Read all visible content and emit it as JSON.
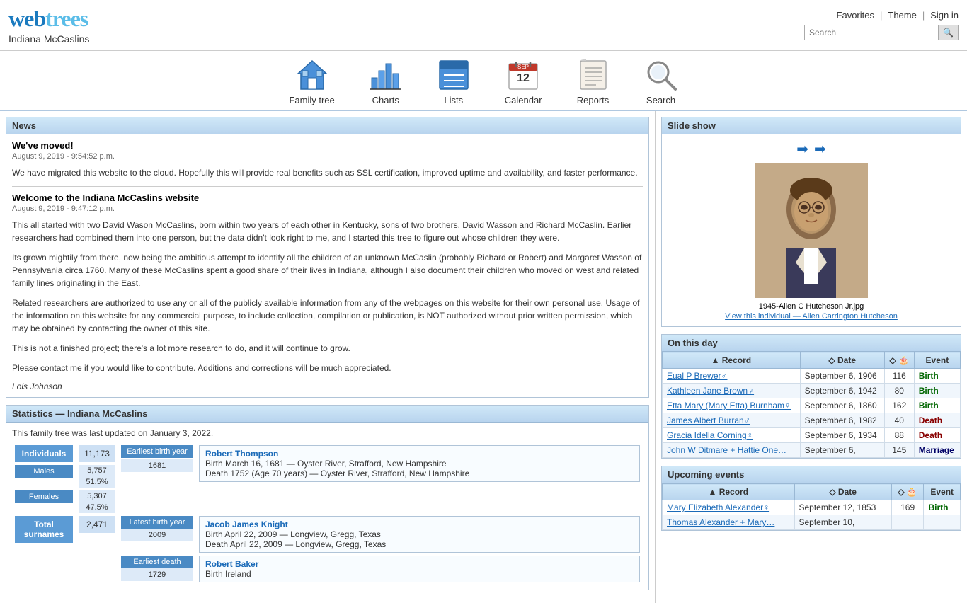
{
  "header": {
    "logo": "webtrees",
    "site_title": "Indiana McCaslins",
    "links": [
      "Favorites",
      "Theme",
      "Sign in"
    ],
    "search_placeholder": "Search"
  },
  "nav": {
    "items": [
      {
        "label": "Family tree",
        "icon": "house"
      },
      {
        "label": "Charts",
        "icon": "chart"
      },
      {
        "label": "Lists",
        "icon": "list"
      },
      {
        "label": "Calendar",
        "icon": "calendar"
      },
      {
        "label": "Reports",
        "icon": "reports"
      },
      {
        "label": "Search",
        "icon": "search"
      }
    ]
  },
  "news": {
    "section_label": "News",
    "items": [
      {
        "title": "We've moved!",
        "date": "August 9, 2019 - 9:54:52 p.m.",
        "text": "We have migrated this website to the cloud. Hopefully this will provide real benefits such as SSL certification, improved uptime and availability, and faster performance."
      },
      {
        "title": "Welcome to the Indiana McCaslins website",
        "date": "August 9, 2019 - 9:47:12 p.m.",
        "text1": "This all started with two David Wason McCaslins, born within two years of each other in Kentucky, sons of two brothers, David Wasson and Richard McCaslin. Earlier researchers had combined them into one person, but the data didn't look right to me, and I started this tree to figure out whose children they were.",
        "text2": "Its grown mightily from there, now being the ambitious attempt to identify all the children of an unknown McCaslin (probably Richard or Robert) and Margaret Wasson of Pennsylvania circa 1760. Many of these McCaslins spent a good share of their lives in Indiana, although I also document their children who moved on west and related family lines originating in the East.",
        "text3": "Related researchers are authorized to use any or all of the publicly available information from any of the webpages on this website for their own personal use. Usage of the information on this website for any commercial purpose, to include collection, compilation or publication, is NOT authorized without prior written permission, which may be obtained by contacting the owner of this site.",
        "text4": "This is not a finished project; there's a lot more research to do, and it will continue to grow.",
        "text5": "Please contact me if you would like to contribute. Additions and corrections will be much appreciated.",
        "signature": "Lois Johnson"
      }
    ]
  },
  "statistics": {
    "section_label": "Statistics — Indiana McCaslins",
    "last_updated": "This family tree was last updated on January 3, 2022.",
    "individuals": {
      "label": "Individuals",
      "value": "11,173"
    },
    "males": {
      "label": "Males",
      "value": "5,757",
      "pct": "51.5%"
    },
    "females": {
      "label": "Females",
      "value": "5,307",
      "pct": "47.5%"
    },
    "total_surnames": {
      "label": "Total surnames",
      "value": "2,471"
    },
    "earliest_birth": {
      "label": "Earliest birth year",
      "year": "1681",
      "name": "Robert Thompson",
      "birth": "Birth  March 16, 1681 — Oyster River, Strafford, New Hampshire",
      "death": "Death  1752 (Age 70 years) — Oyster River, Strafford, New Hampshire"
    },
    "latest_birth": {
      "label": "Latest birth year",
      "year": "2009",
      "name": "Jacob James Knight",
      "birth": "Birth  April 22, 2009 — Longview, Gregg, Texas",
      "death": "Death  April 22, 2009 — Longview, Gregg, Texas"
    },
    "earliest_death": {
      "label": "Earliest death",
      "year": "1729",
      "name": "Robert Baker",
      "birth": "Birth  Ireland"
    }
  },
  "slideshow": {
    "section_label": "Slide show",
    "image_caption": "1945-Allen C Hutcheson Jr.jpg",
    "image_link": "View this individual — Allen Carrington Hutcheson"
  },
  "on_this_day": {
    "section_label": "On this day",
    "columns": [
      "Record",
      "Date",
      "🎂",
      "Event"
    ],
    "rows": [
      {
        "record": "Eual P Brewer♂",
        "date": "September 6, 1906",
        "age": "116",
        "event": "Birth"
      },
      {
        "record": "Kathleen Jane Brown♀",
        "date": "September 6, 1942",
        "age": "80",
        "event": "Birth"
      },
      {
        "record": "Etta Mary (Mary Etta) Burnham♀",
        "date": "September 6, 1860",
        "age": "162",
        "event": "Birth"
      },
      {
        "record": "James Albert Burran♂",
        "date": "September 6, 1982",
        "age": "40",
        "event": "Death"
      },
      {
        "record": "Gracia Idella Corning♀",
        "date": "September 6, 1934",
        "age": "88",
        "event": "Death"
      },
      {
        "record": "John W Ditmare + Hattie One…",
        "date": "September 6,",
        "age": "145",
        "event": "Marriage"
      }
    ]
  },
  "upcoming_events": {
    "section_label": "Upcoming events",
    "columns": [
      "Record",
      "Date",
      "🎂",
      "Event"
    ],
    "rows": [
      {
        "record": "Mary Elizabeth Alexander♀",
        "date": "September 12, 1853",
        "age": "169",
        "event": "Birth"
      },
      {
        "record": "Thomas Alexander + Mary…",
        "date": "September 10,",
        "age": "",
        "event": ""
      }
    ]
  }
}
